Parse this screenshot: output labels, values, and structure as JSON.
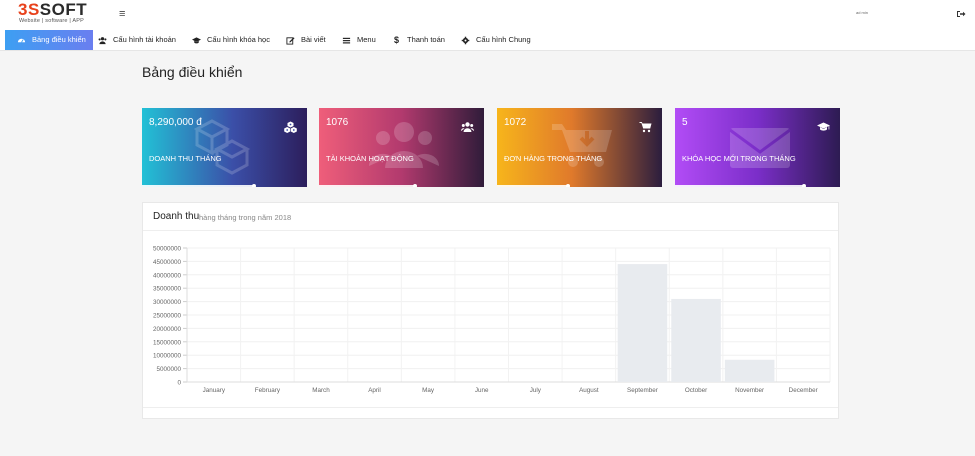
{
  "header": {
    "logo": {
      "brand_red": "3S",
      "brand_dark": "SOFT",
      "tagline": "Website | software | APP"
    },
    "hamburger": "≡",
    "user_name": "ad min"
  },
  "nav": [
    {
      "label": "Bảng điều khiển",
      "icon": "dashboard-icon",
      "active": true
    },
    {
      "label": "Cấu hình tài khoản",
      "icon": "users-icon",
      "active": false
    },
    {
      "label": "Cấu hình khóa học",
      "icon": "graduation-cap-icon",
      "active": false
    },
    {
      "label": "Bài viết",
      "icon": "edit-icon",
      "active": false
    },
    {
      "label": "Menu",
      "icon": "list-icon",
      "active": false
    },
    {
      "label": "Thanh toán",
      "icon": "dollar-icon",
      "active": false
    },
    {
      "label": "Cấu hình Chung",
      "icon": "gear-icon",
      "active": false
    }
  ],
  "page_title": "Bảng điều khiển",
  "cards": [
    {
      "value": "8,290,000 đ",
      "label": "DOANH THU THÁNG",
      "icon": "cubes-icon",
      "progress": 0.68,
      "accent": "#22c1d6"
    },
    {
      "value": "1076",
      "label": "TÀI KHOẢN HOẠT ĐỘNG",
      "icon": "users-icon",
      "progress": 0.58,
      "accent": "#ef5e7a"
    },
    {
      "value": "1072",
      "label": "ĐƠN HÀNG TRONG THÁNG",
      "icon": "cart-icon",
      "progress": 0.43,
      "accent": "#f7b51b"
    },
    {
      "value": "5",
      "label": "KHÓA HỌC MỚI TRONG THÁNG",
      "icon": "graduation-cap-icon",
      "progress": 0.78,
      "accent": "#b24cf6"
    }
  ],
  "revenue": {
    "title": "Doanh thu",
    "subtitle": "hàng tháng trong năm 2018"
  },
  "chart_data": {
    "type": "bar",
    "categories": [
      "January",
      "February",
      "March",
      "April",
      "May",
      "June",
      "July",
      "August",
      "September",
      "October",
      "November",
      "December"
    ],
    "values": [
      0,
      0,
      0,
      0,
      0,
      0,
      0,
      0,
      44000000,
      31000000,
      8300000,
      0
    ],
    "yticks": [
      "0",
      "5000000",
      "10000000",
      "15000000",
      "20000000",
      "25000000",
      "30000000",
      "35000000",
      "40000000",
      "45000000",
      "50000000"
    ],
    "ylim": [
      0,
      50000000
    ],
    "bar_color": "#e8ebef",
    "grid": true
  }
}
